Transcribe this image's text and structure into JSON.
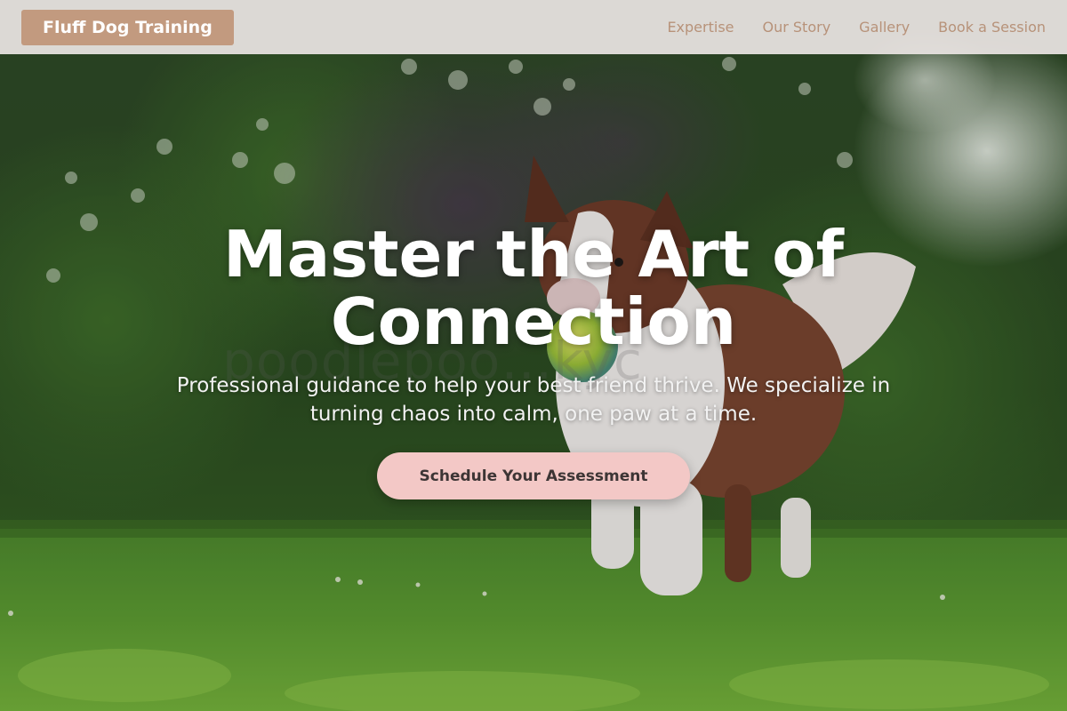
{
  "header": {
    "brand": "Fluff Dog Training",
    "nav": [
      {
        "label": "Expertise"
      },
      {
        "label": "Our Story"
      },
      {
        "label": "Gallery"
      },
      {
        "label": "Book a Session"
      }
    ]
  },
  "hero": {
    "headline": "Master the Art of Connection",
    "subtitle": "Professional guidance to help your best friend thrive. We specialize in turning chaos into calm, one paw at a time.",
    "watermark": "poodlepoo…kyc",
    "cta_label": "Schedule Your Assessment",
    "image": "border-collie-with-ball-on-grass"
  },
  "colors": {
    "header_bg": "#e8e2e0",
    "brand_bg": "#c29a7f",
    "nav_text": "#b79279",
    "cta_bg": "#f3c8c6",
    "cta_text": "#3d3535",
    "headline": "#ffffff"
  }
}
